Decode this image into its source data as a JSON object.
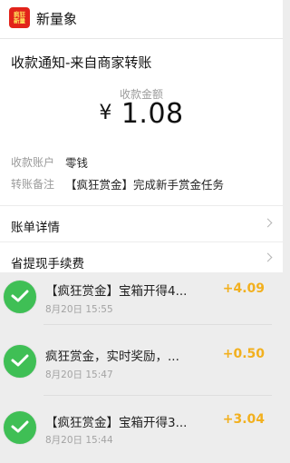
{
  "app": {
    "logo_text_1": "疯狂",
    "logo_text_2": "新量",
    "logo_tag": "",
    "name": "新量象"
  },
  "notice": {
    "title": "收款通知-来自商家转账",
    "amount_label": "收款金额",
    "currency_symbol": "¥",
    "amount": "1.08",
    "account_label": "收款账户",
    "account_value": "零钱",
    "remark_label": "转账备注",
    "remark_value": "【疯狂赏金】完成新手赏金任务"
  },
  "links": [
    {
      "label": "账单详情"
    },
    {
      "label": "省提现手续费"
    }
  ],
  "messages": [
    {
      "title": "【疯狂赏金】宝箱开得4...",
      "time": "8月20日 15:55",
      "amount": "+4.09"
    },
    {
      "title": "疯狂赏金，实时奖励，...",
      "time": "8月20日 15:47",
      "amount": "+0.50"
    },
    {
      "title": "【疯狂赏金】宝箱开得3...",
      "time": "8月20日 15:44",
      "amount": "+3.04"
    }
  ],
  "colors": {
    "accent_amount": "#f2b01e",
    "wechat_green": "#3fbf55",
    "logo_red": "#e2231a"
  }
}
